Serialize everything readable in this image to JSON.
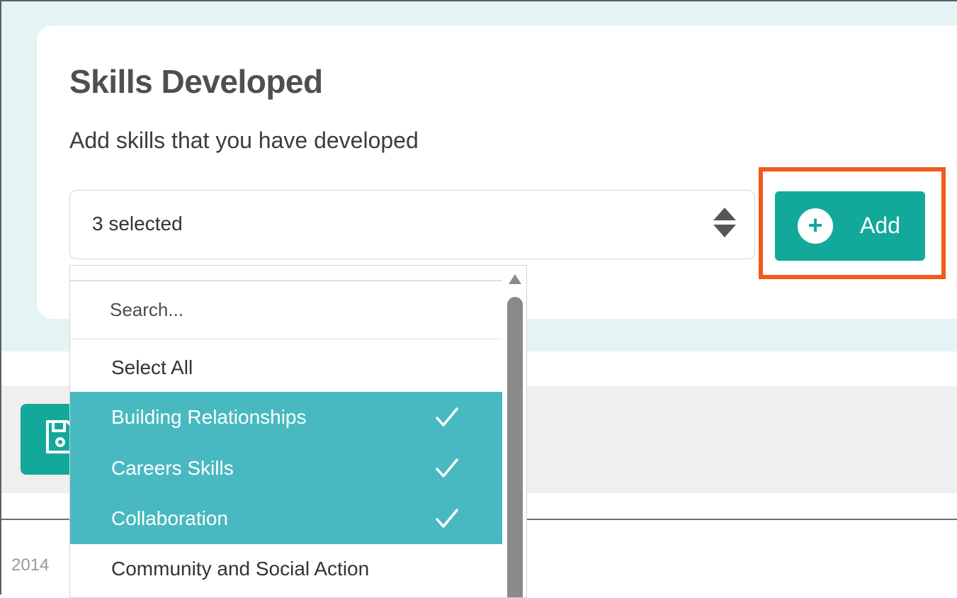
{
  "section": {
    "title": "Skills Developed",
    "subtitle": "Add skills that you have developed"
  },
  "skills_select": {
    "value": "3 selected"
  },
  "add_button": {
    "label": "Add",
    "plus": "+"
  },
  "dropdown": {
    "search_placeholder": "Search...",
    "select_all_label": "Select All",
    "options": [
      {
        "label": "Building Relationships",
        "selected": true
      },
      {
        "label": "Careers Skills",
        "selected": true
      },
      {
        "label": "Collaboration",
        "selected": true
      },
      {
        "label": "Community and Social Action",
        "selected": false
      }
    ]
  },
  "footer": {
    "copyright_fragment": "2014"
  },
  "colors": {
    "accent": "#12a99a",
    "selected_option": "#48b9c0",
    "highlight_outline": "#f05a1a",
    "section_background": "#e4f3f3"
  },
  "icons": {
    "sort": "sort-icon",
    "plus": "plus-circle-icon",
    "check": "check-icon",
    "save": "save-icon"
  }
}
